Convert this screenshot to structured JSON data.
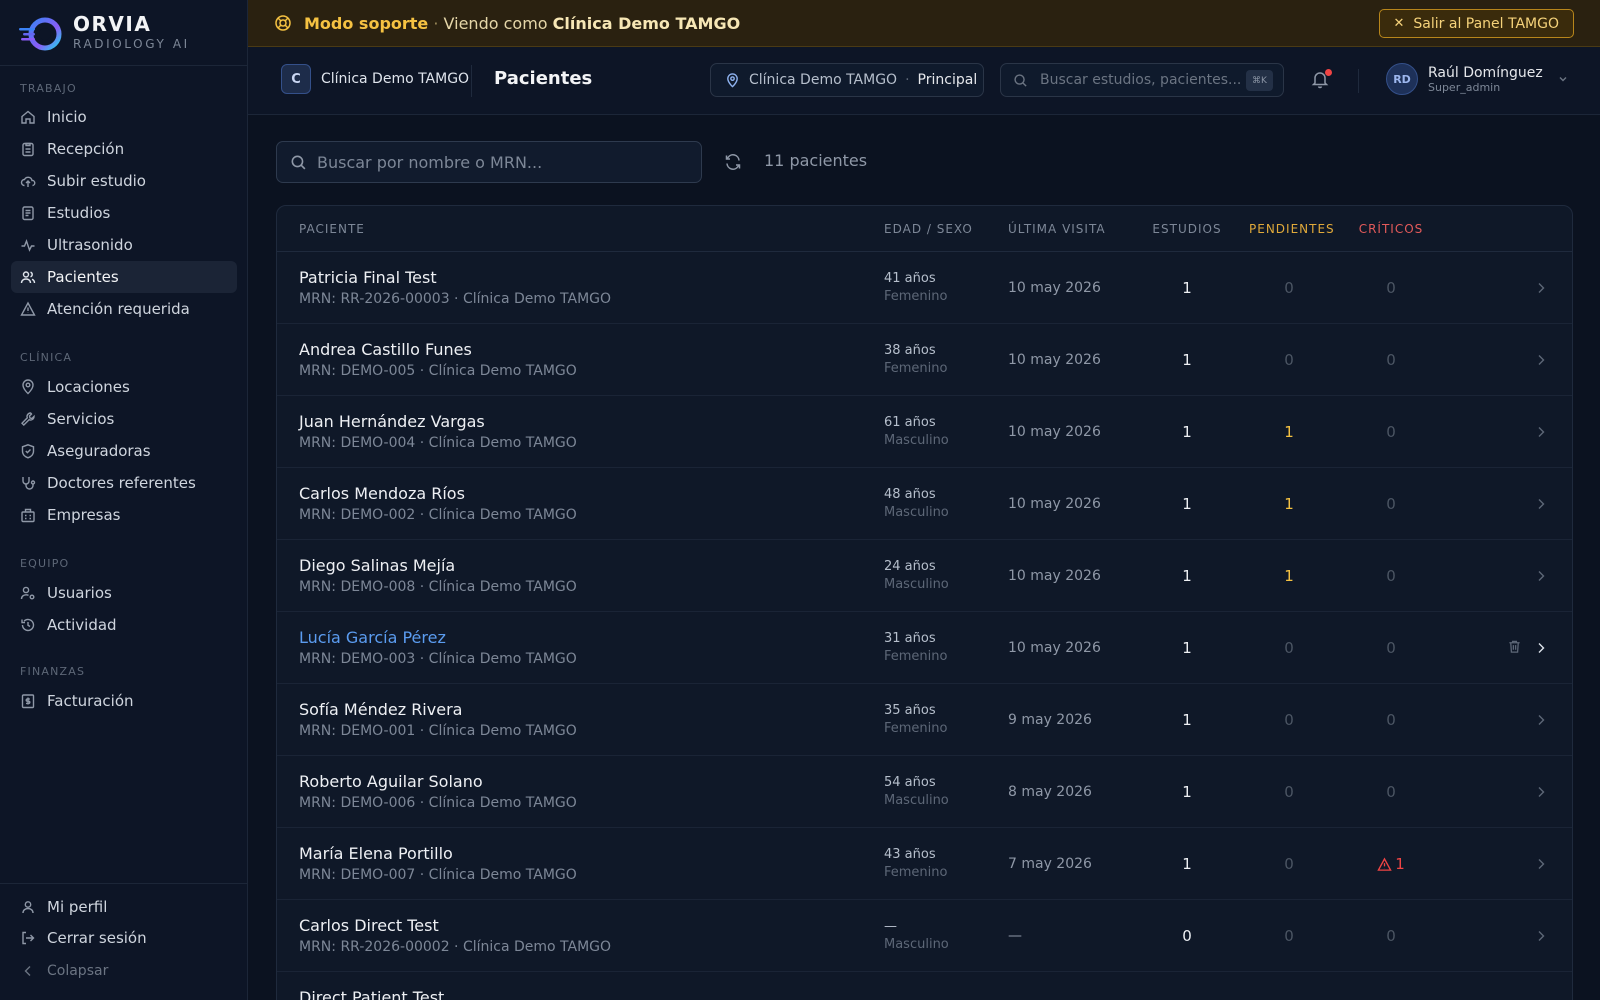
{
  "brand": {
    "name": "ORVIA",
    "sub": "RADIOLOGY AI"
  },
  "sidebar": {
    "sections": [
      {
        "title": "TRABAJO"
      },
      {
        "title": "CLÍNICA"
      },
      {
        "title": "EQUIPO"
      },
      {
        "title": "FINANZAS"
      }
    ],
    "items": [
      {
        "label": "Inicio",
        "icon": "home-icon"
      },
      {
        "label": "Recepción",
        "icon": "clipboard-icon"
      },
      {
        "label": "Subir estudio",
        "icon": "cloud-upload-icon"
      },
      {
        "label": "Estudios",
        "icon": "document-icon"
      },
      {
        "label": "Ultrasonido",
        "icon": "activity-icon"
      },
      {
        "label": "Pacientes",
        "icon": "users-icon"
      },
      {
        "label": "Atención requerida",
        "icon": "warning-icon"
      },
      {
        "label": "Locaciones",
        "icon": "map-pin-icon"
      },
      {
        "label": "Servicios",
        "icon": "wrench-icon"
      },
      {
        "label": "Aseguradoras",
        "icon": "shield-icon"
      },
      {
        "label": "Doctores referentes",
        "icon": "stethoscope-icon"
      },
      {
        "label": "Empresas",
        "icon": "building-icon"
      },
      {
        "label": "Usuarios",
        "icon": "user-cog-icon"
      },
      {
        "label": "Actividad",
        "icon": "history-icon"
      },
      {
        "label": "Facturación",
        "icon": "receipt-icon"
      }
    ],
    "bottom": [
      {
        "label": "Mi perfil",
        "icon": "user-icon"
      },
      {
        "label": "Cerrar sesión",
        "icon": "logout-icon"
      },
      {
        "label": "Colapsar",
        "icon": "chevron-left-icon"
      }
    ]
  },
  "banner": {
    "mode": "Modo soporte",
    "viewing_prefix": "Viendo como",
    "org": "Clínica Demo TAMGO",
    "exit_label": "Salir al Panel TAMGO"
  },
  "topbar": {
    "clinic_initial": "C",
    "clinic_name": "Clínica Demo TAMGO",
    "page_title": "Pacientes",
    "location_clinic": "Clínica Demo TAMGO",
    "location_branch": "Principal",
    "search_placeholder": "Buscar estudios, pacientes...",
    "search_shortcut": "⌘K",
    "user_initials": "RD",
    "user_name": "Raúl Domínguez",
    "user_role": "Super_admin"
  },
  "main": {
    "search_placeholder": "Buscar por nombre o MRN...",
    "count_label": "11 pacientes",
    "columns": {
      "patient": "PACIENTE",
      "age_sex": "EDAD / SEXO",
      "last_visit": "ÚLTIMA VISITA",
      "studies": "ESTUDIOS",
      "pending": "PENDIENTES",
      "critical": "CRÍTICOS"
    },
    "rows": [
      {
        "name": "Patricia Final Test",
        "mrn": "MRN: RR-2026-00003 · Clínica Demo TAMGO",
        "age": "41 años",
        "sex": "Femenino",
        "visit": "10 may 2026",
        "studies": "1",
        "pending": "0",
        "critical": "0"
      },
      {
        "name": "Andrea Castillo Funes",
        "mrn": "MRN: DEMO-005 · Clínica Demo TAMGO",
        "age": "38 años",
        "sex": "Femenino",
        "visit": "10 may 2026",
        "studies": "1",
        "pending": "0",
        "critical": "0"
      },
      {
        "name": "Juan Hernández Vargas",
        "mrn": "MRN: DEMO-004 · Clínica Demo TAMGO",
        "age": "61 años",
        "sex": "Masculino",
        "visit": "10 may 2026",
        "studies": "1",
        "pending": "1",
        "critical": "0"
      },
      {
        "name": "Carlos Mendoza Ríos",
        "mrn": "MRN: DEMO-002 · Clínica Demo TAMGO",
        "age": "48 años",
        "sex": "Masculino",
        "visit": "10 may 2026",
        "studies": "1",
        "pending": "1",
        "critical": "0"
      },
      {
        "name": "Diego Salinas Mejía",
        "mrn": "MRN: DEMO-008 · Clínica Demo TAMGO",
        "age": "24 años",
        "sex": "Masculino",
        "visit": "10 may 2026",
        "studies": "1",
        "pending": "1",
        "critical": "0"
      },
      {
        "name": "Lucía García Pérez",
        "mrn": "MRN: DEMO-003 · Clínica Demo TAMGO",
        "age": "31 años",
        "sex": "Femenino",
        "visit": "10 may 2026",
        "studies": "1",
        "pending": "0",
        "critical": "0"
      },
      {
        "name": "Sofía Méndez Rivera",
        "mrn": "MRN: DEMO-001 · Clínica Demo TAMGO",
        "age": "35 años",
        "sex": "Femenino",
        "visit": "9 may 2026",
        "studies": "1",
        "pending": "0",
        "critical": "0"
      },
      {
        "name": "Roberto Aguilar Solano",
        "mrn": "MRN: DEMO-006 · Clínica Demo TAMGO",
        "age": "54 años",
        "sex": "Masculino",
        "visit": "8 may 2026",
        "studies": "1",
        "pending": "0",
        "critical": "0"
      },
      {
        "name": "María Elena Portillo",
        "mrn": "MRN: DEMO-007 · Clínica Demo TAMGO",
        "age": "43 años",
        "sex": "Femenino",
        "visit": "7 may 2026",
        "studies": "1",
        "pending": "0",
        "critical": "1"
      },
      {
        "name": "Carlos Direct Test",
        "mrn": "MRN: RR-2026-00002 · Clínica Demo TAMGO",
        "age": "—",
        "sex": "Masculino",
        "visit": "—",
        "studies": "0",
        "pending": "0",
        "critical": "0"
      },
      {
        "name": "Direct Patient Test",
        "mrn": "",
        "age": "",
        "sex": "",
        "visit": "",
        "studies": "",
        "pending": "",
        "critical": ""
      }
    ]
  },
  "colors": {
    "accent": "#5b9cf0",
    "warning": "#f5c242",
    "critical": "#ef4444",
    "banner_bg": "#2a2110"
  }
}
